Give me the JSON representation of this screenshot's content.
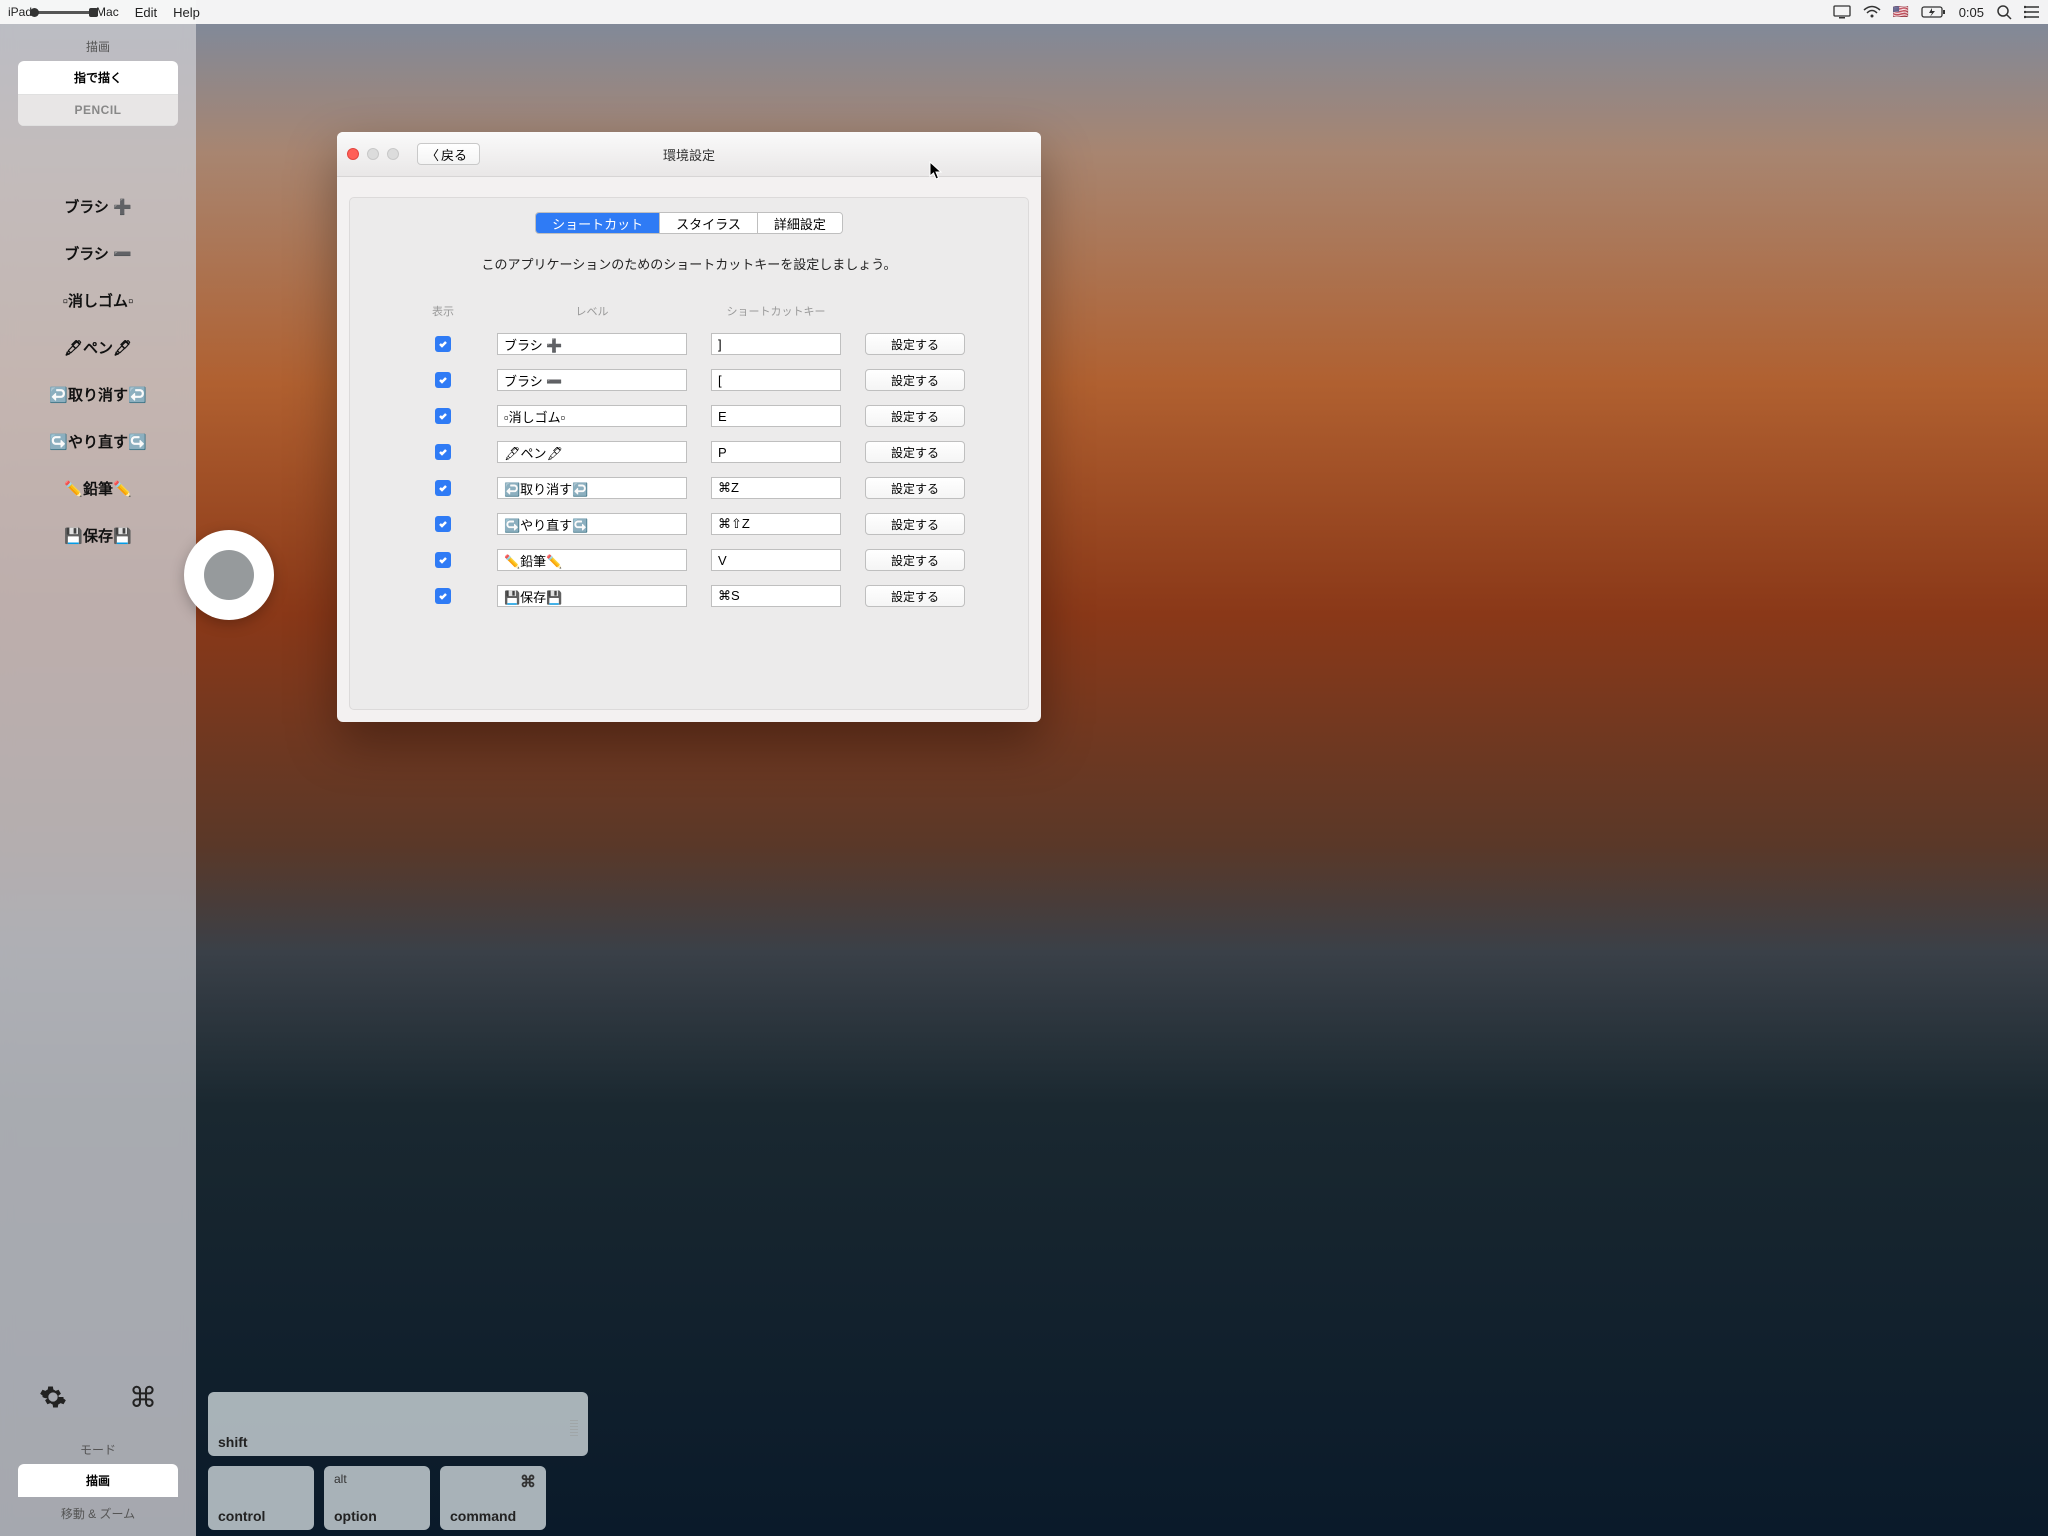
{
  "menubar": {
    "ipad": "iPad",
    "mac": "Mac",
    "menus": [
      "Edit",
      "Help"
    ],
    "flag": "🇺🇸",
    "time": "0:05"
  },
  "sidebar": {
    "draw_title": "描画",
    "btn_finger": "指で描く",
    "btn_pencil": "PENCIL",
    "tools": [
      "ブラシ ➕",
      "ブラシ ➖",
      "▫消しゴム▫",
      "🖋ペン🖋",
      "↩️取り消す↩️",
      "↪️やり直す↪️",
      "✏️鉛筆✏️",
      "💾保存💾"
    ],
    "mode_title": "モード",
    "mode_draw": "描画",
    "mode_movezoom": "移動 & ズーム"
  },
  "keypads": {
    "shift": "shift",
    "control": "control",
    "option": "option",
    "option_alt": "alt",
    "command": "command"
  },
  "window": {
    "back": "戻る",
    "title": "環境設定",
    "tabs": {
      "shortcuts": "ショートカット",
      "stylus": "スタイラス",
      "advanced": "詳細設定"
    },
    "subtitle": "このアプリケーションのためのショートカットキーを設定しましょう。",
    "headers": {
      "show": "表示",
      "label": "レベル",
      "key": "ショートカットキー"
    },
    "set_btn": "設定する",
    "rows": [
      {
        "label": "ブラシ ➕",
        "key": "]"
      },
      {
        "label": "ブラシ ➖",
        "key": "["
      },
      {
        "label": "▫消しゴム▫",
        "key": "E"
      },
      {
        "label": "🖋ペン🖋",
        "key": "P"
      },
      {
        "label": "↩️取り消す↩️",
        "key": "⌘Z"
      },
      {
        "label": "↪️やり直す↪️",
        "key": "⌘⇧Z"
      },
      {
        "label": "✏️鉛筆✏️",
        "key": "V"
      },
      {
        "label": "💾保存💾",
        "key": "⌘S"
      }
    ]
  }
}
